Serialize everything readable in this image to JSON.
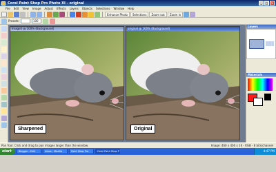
{
  "window": {
    "title": "Corel Paint Shop Pro Photo XI - original",
    "minimize": "_",
    "maximize": "□",
    "close": "×"
  },
  "menu": [
    "File",
    "Edit",
    "View",
    "Image",
    "Adjust",
    "Effects",
    "Layers",
    "Objects",
    "Selections",
    "Window",
    "Help"
  ],
  "toolbar": {
    "enhance_label": "Enhance Photo",
    "selections_label": "Selections",
    "zoom_label": "Zoom out",
    "zoom_in_label": "Zoom in"
  },
  "tool_options": {
    "mode_label": "Presets:",
    "zoom_value": "100"
  },
  "documents": {
    "left": {
      "title": "Image5 @ 100% (Background)",
      "label": "Sharpened"
    },
    "right": {
      "title": "original @ 100% (Background)",
      "label": "Original"
    }
  },
  "panels": {
    "layers_title": "Layers",
    "materials_title": "Materials"
  },
  "status": {
    "left": "Pan Tool: Click and drag to pan images larger than the window.",
    "right": "Image: 460 x 400 x 16 - RGB - 8 bits/channel"
  },
  "taskbar": {
    "start": "start",
    "tasks": [
      "Blogger - Edit",
      "Inbox - Mozilla",
      "Paint Shop Pro",
      "Corel Paint Shop Pro"
    ],
    "clock": "4:47 PM"
  }
}
